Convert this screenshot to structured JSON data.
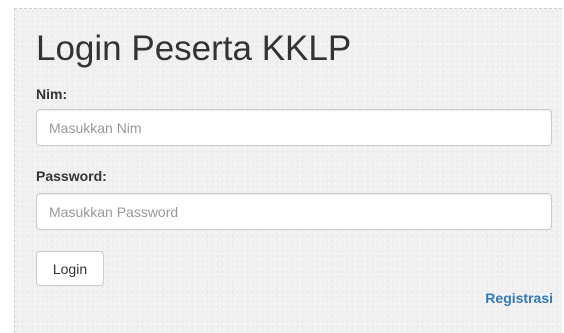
{
  "form": {
    "title": "Login Peserta KKLP",
    "nim": {
      "label": "Nim:",
      "placeholder": "Masukkan Nim",
      "value": ""
    },
    "password": {
      "label": "Password:",
      "placeholder": "Masukkan Password",
      "value": ""
    },
    "login_label": "Login",
    "register_label": "Registrasi"
  },
  "colors": {
    "link": "#337ab7",
    "text": "#333333",
    "panel_background": "#f1f1f1"
  }
}
